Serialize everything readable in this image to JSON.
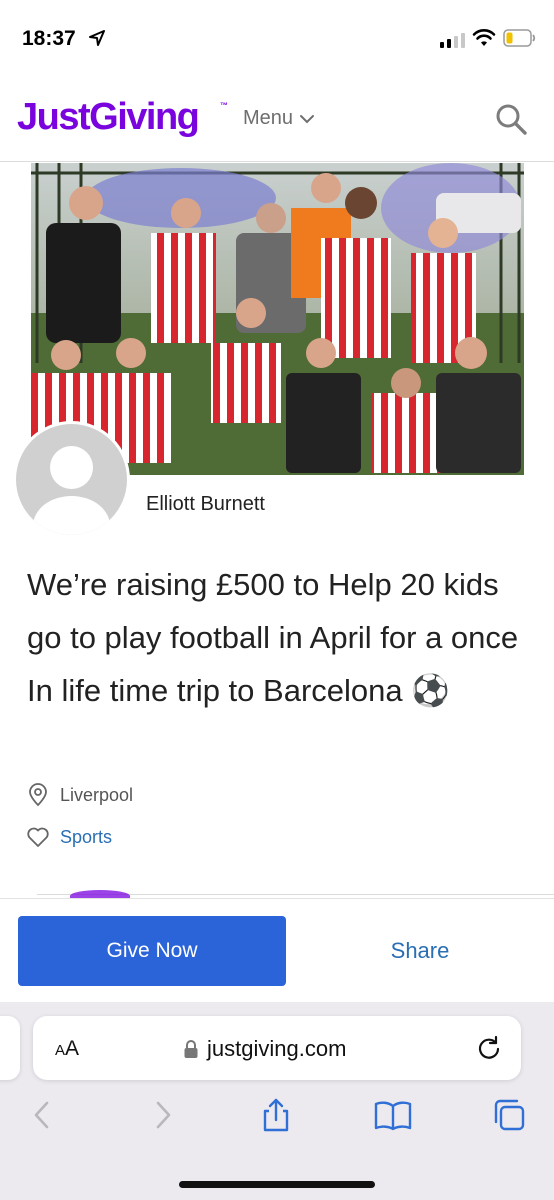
{
  "status": {
    "time": "18:37"
  },
  "header": {
    "logo": "JustGiving",
    "logo_tm": "™",
    "menu_label": "Menu"
  },
  "page": {
    "owner_name": "Elliott Burnett",
    "title": "We’re raising £500 to Help 20 kids go to play football in April for a once In life time trip to Barcelona ⚽",
    "location": "Liverpool",
    "category": "Sports"
  },
  "actions": {
    "give_label": "Give Now",
    "share_label": "Share"
  },
  "browser": {
    "text_size_label_small": "A",
    "text_size_label_large": "A",
    "domain": "justgiving.com"
  },
  "colors": {
    "brand": "#7a04dd",
    "primary_button": "#2b63d9",
    "link": "#2a6fb3"
  },
  "icons": [
    "location-arrow-icon",
    "signal-icon",
    "wifi-icon",
    "battery-icon",
    "chevron-down-icon",
    "search-icon",
    "location-pin-icon",
    "heart-icon",
    "lock-icon",
    "reload-icon",
    "back-icon",
    "forward-icon",
    "share-icon",
    "bookmarks-icon",
    "tabs-icon"
  ]
}
